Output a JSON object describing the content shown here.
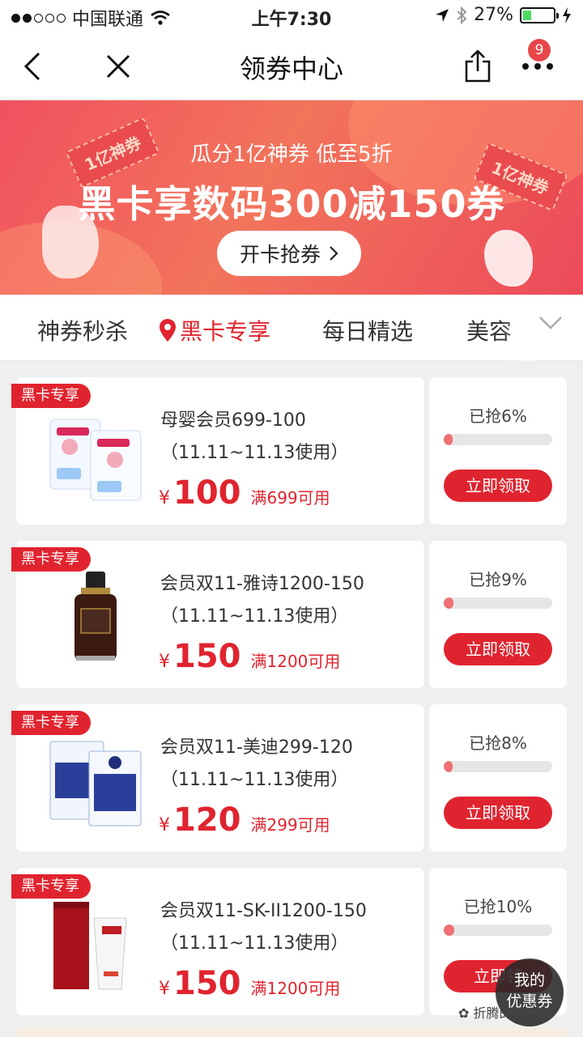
{
  "status_bar": {
    "carrier": "中国联通",
    "time": "上午7:30",
    "battery": "27%",
    "battery_level": 0.27
  },
  "nav": {
    "title": "领券中心",
    "more_badge": "9"
  },
  "banner": {
    "subtitle": "瓜分1亿神券 低至5折",
    "headline": "黑卡享数码300减150券",
    "cta": "开卡抢券",
    "ticket_left": "1亿神券",
    "ticket_right": "1亿神券"
  },
  "tabs": [
    {
      "label": "神券秒杀"
    },
    {
      "label": "黑卡专享"
    },
    {
      "label": "每日精选"
    },
    {
      "label": "美容"
    }
  ],
  "coupons": [
    {
      "tag": "黑卡专享",
      "title": "母婴会员699-100（11.11~11.13使用）",
      "currency": "¥",
      "amount": "100",
      "condition": "满699可用",
      "claimed": "已抢6%",
      "progress": 0.06,
      "button": "立即领取",
      "product_icon": "diaper-pack-icon"
    },
    {
      "tag": "黑卡专享",
      "title": "会员双11-雅诗1200-150（11.11~11.13使用）",
      "currency": "¥",
      "amount": "150",
      "condition": "满1200可用",
      "claimed": "已抢9%",
      "progress": 0.09,
      "button": "立即领取",
      "product_icon": "serum-bottle-icon"
    },
    {
      "tag": "黑卡专享",
      "title": "会员双11-美迪299-120（11.11~11.13使用）",
      "currency": "¥",
      "amount": "120",
      "condition": "满299可用",
      "claimed": "已抢8%",
      "progress": 0.08,
      "button": "立即领取",
      "product_icon": "face-mask-box-icon"
    },
    {
      "tag": "黑卡专享",
      "title": "会员双11-SK-II1200-150（11.11~11.13使用）",
      "currency": "¥",
      "amount": "150",
      "condition": "满1200可用",
      "claimed": "已抢10%",
      "progress": 0.1,
      "button": "立即领",
      "product_icon": "skincare-set-icon"
    }
  ],
  "float_button": {
    "line1": "我的",
    "line2": "优惠券"
  },
  "watermark": "折腾的Emma",
  "colors": {
    "accent": "#e0242f",
    "banner": "#f1515f",
    "progress": "#ef6f73"
  }
}
